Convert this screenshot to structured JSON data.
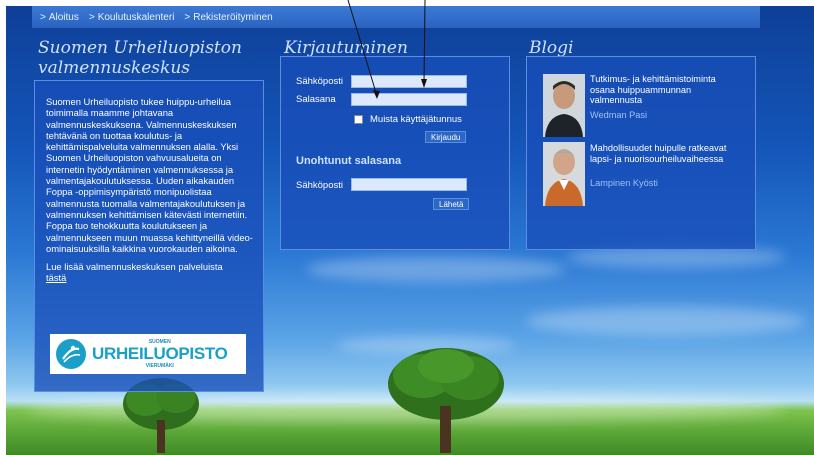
{
  "nav": {
    "items": [
      {
        "label": "Aloitus"
      },
      {
        "label": "Koulutuskalenteri"
      },
      {
        "label": "Rekisteröityminen"
      }
    ]
  },
  "left": {
    "heading_line1": "Suomen Urheiluopiston",
    "heading_line2": "valmennuskeskus",
    "paragraph": "Suomen Urheiluopisto tukee huippu-urheilua toimimalla maamme johtavana valmennuskeskuksena. Valmennuskeskuksen tehtävänä on tuottaa koulutus- ja kehittämispalveluita valmennuksen alalla. Yksi Suomen Urheiluopiston vahvuusalueita on internetin hyödyntäminen valmennuksessa ja valmentajakoulutuksessa. Uuden aikakauden Foppa -oppimisympäristö monipuolistaa valmennusta tuomalla valmentajakoulutuksen ja valmennuksen kehittämisen kätevästi internetiin. Foppa tuo tehokkuutta koulutukseen ja valmennukseen muun muassa kehittyneillä video-ominaisuuksilla kaikkina vuorokauden aikoina.",
    "more_text": "Lue lisää valmennuskeskuksen palveluista",
    "more_link": "tästä",
    "logo": {
      "small_top": "SUOMEN",
      "big": "URHEILUOPISTO",
      "small_bottom": "VIERUMÄKI"
    }
  },
  "login": {
    "heading": "Kirjautuminen",
    "email_label": "Sähköposti",
    "password_label": "Salasana",
    "remember_label": "Muista käyttäjätunnus",
    "login_button": "Kirjaudu",
    "forgot_heading": "Unohtunut salasana",
    "forgot_email_label": "Sähköposti",
    "send_button": "Lähetä",
    "email_value": "",
    "password_value": "",
    "forgot_email_value": ""
  },
  "blog": {
    "heading": "Blogi",
    "posts": [
      {
        "title": "Tutkimus- ja kehittämistoiminta osana huippuammunnan valmennusta",
        "author": "Wedman Pasi"
      },
      {
        "title": "Mahdollisuudet huipulle ratkeavat lapsi- ja nuorisourheiluvaiheessa",
        "author": "Lampinen Kyösti"
      }
    ]
  },
  "colors": {
    "panel": "#184eb8",
    "nav": "#2b64c0",
    "heading": "#cfe1ff",
    "author": "#9fc2f5"
  }
}
